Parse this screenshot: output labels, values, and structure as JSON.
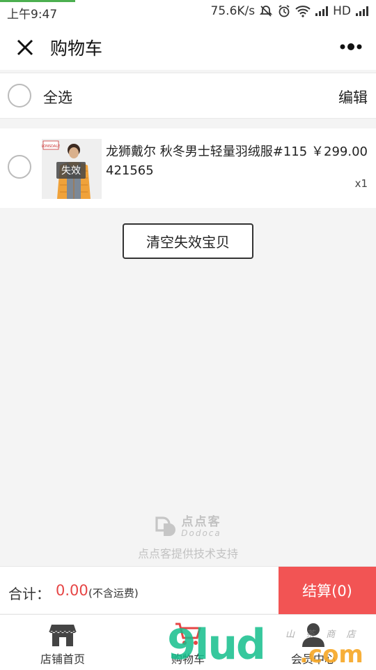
{
  "status_bar": {
    "time": "上午9:47",
    "network_speed": "75.6K/s",
    "hd_label": "HD",
    "progress": 0.2
  },
  "nav": {
    "title": "购物车"
  },
  "cart": {
    "select_all_label": "全选",
    "edit_label": "编辑",
    "items": [
      {
        "name": "龙狮戴尔 秋冬男士轻量羽绒服#115421565",
        "price": "￥299.00",
        "quantity": "x1",
        "status_badge": "失效",
        "thumb_brand": "Lonsdale"
      }
    ],
    "clear_invalid_label": "清空失效宝贝"
  },
  "footer_brand": {
    "logo_cn": "点点客",
    "logo_en": "Dodoca",
    "support_text": "点点客提供技术支持"
  },
  "checkout": {
    "total_label": "合计：",
    "total_amount": "0.00",
    "shipping_note": "(不含运费)",
    "button_label": "结算(0)",
    "button_color": "#f25454"
  },
  "tabbar": {
    "tabs": [
      {
        "label": "店铺首页",
        "icon": "store-icon"
      },
      {
        "label": "购物车",
        "icon": "cart-icon"
      },
      {
        "label": "会员中心",
        "icon": "user-icon"
      }
    ]
  },
  "watermark": {
    "text": "9lud",
    "suffix": ".com",
    "subtitle": "山 茶 商 店"
  },
  "colors": {
    "accent_red": "#e64545",
    "checkout_red": "#f25454",
    "watermark_green": "#14be8c",
    "watermark_orange": "#f6a623"
  }
}
